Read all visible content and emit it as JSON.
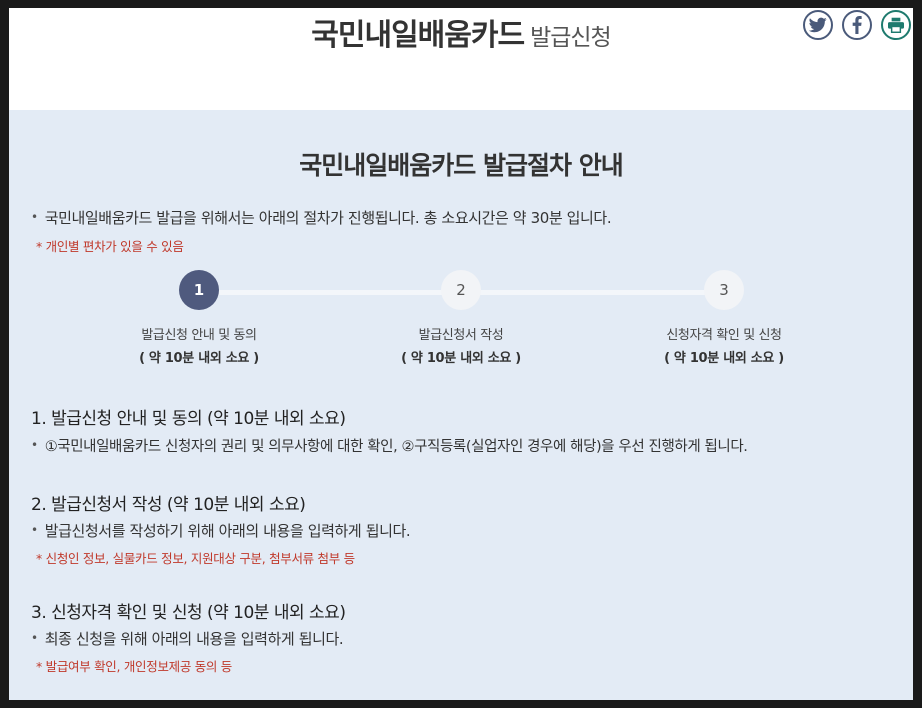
{
  "header": {
    "title_main": "국민내일배움카드",
    "title_sub": "발급신청",
    "share": {
      "twitter_icon": "twitter-icon",
      "facebook_icon": "facebook-icon",
      "print_icon": "printer-icon"
    }
  },
  "guide": {
    "title": "국민내일배움카드 발급절차 안내",
    "intro": "국민내일배움카드 발급을 위해서는 아래의 절차가 진행됩니다. 총 소요시간은 약 30분 입니다.",
    "intro_note": "* 개인별 편차가 있을 수 있음",
    "steps": [
      {
        "number": "1",
        "label": "발급신청 안내 및 동의",
        "duration": "( 약 10분 내외 소요 )",
        "active": true
      },
      {
        "number": "2",
        "label": "발급신청서 작성",
        "duration": "( 약 10분 내외 소요 )",
        "active": false
      },
      {
        "number": "3",
        "label": "신청자격 확인 및 신청",
        "duration": "( 약 10분 내외 소요 )",
        "active": false
      }
    ],
    "sections": [
      {
        "heading": "1. 발급신청 안내 및 동의 (약 10분 내외 소요)",
        "text": "①국민내일배움카드 신청자의 권리 및 의무사항에 대한 확인, ②구직등록(실업자인 경우에 해당)을 우선 진행하게 됩니다."
      },
      {
        "heading": "2. 발급신청서 작성 (약 10분 내외 소요)",
        "text": "발급신청서를 작성하기 위해 아래의 내용을 입력하게 됩니다.",
        "note": "* 신청인 정보, 실물카드 정보, 지원대상 구분, 첨부서류 첨부 등"
      },
      {
        "heading": "3. 신청자격 확인 및 신청 (약 10분 내외 소요)",
        "text": "최종 신청을 위해 아래의 내용을 입력하게 됩니다.",
        "note": "* 발급여부 확인, 개인정보제공 동의 등"
      }
    ]
  },
  "colors": {
    "background_panel": "#e3ebf5",
    "step_active": "#4f5a7e",
    "note_red": "#c0392b",
    "icon_border": "#4a5a7a",
    "print_border": "#1e7a6e"
  }
}
